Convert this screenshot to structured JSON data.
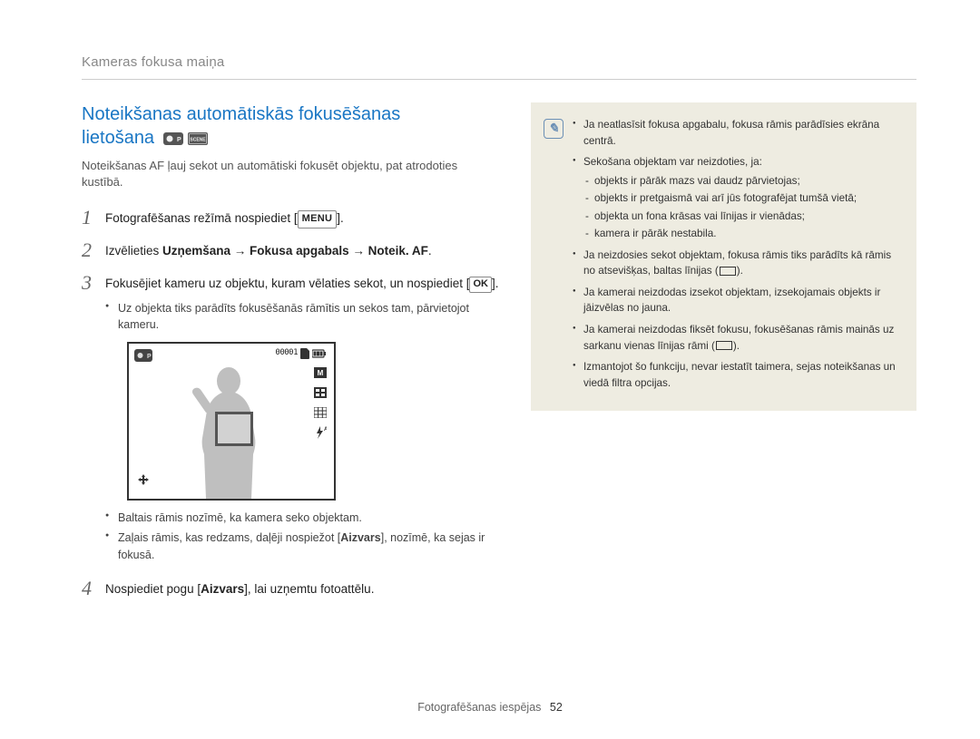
{
  "header": "Kameras fokusa maiņa",
  "title_line1": "Noteikšanas automātiskās fokusēšanas",
  "title_line2": "lietošana",
  "intro": "Noteikšanas AF ļauj sekot un automātiski fokusēt objektu, pat atrodoties kustībā.",
  "step1_pre": "Fotografēšanas režīmā nospiediet [",
  "step1_btn": "MENU",
  "step1_post": "].",
  "step2_pre": "Izvēlieties ",
  "step2_bold": "Uzņemšana → Fokusa apgabals → Noteik. AF",
  "step2_post": ".",
  "step3_pre": "Fokusējiet kameru uz objektu, kuram vēlaties sekot, un nospiediet [",
  "step3_btn": "OK",
  "step3_post": "].",
  "step3_sub1": "Uz objekta tiks parādīts fokusēšanās rāmītis un sekos tam, pārvietojot kameru.",
  "camera_counter": "00001",
  "step3_sub2": "Baltais rāmis nozīmē, ka kamera seko objektam.",
  "step3_sub3_pre": "Zaļais rāmis, kas redzams, daļēji nospiežot [",
  "step3_sub3_bold": "Aizvars",
  "step3_sub3_post": "], nozīmē, ka sejas ir fokusā.",
  "step4_pre": "Nospiediet pogu [",
  "step4_bold": "Aizvars",
  "step4_post": "], lai uzņemtu fotoattēlu.",
  "note": {
    "b1": "Ja neatlasīsit fokusa apgabalu, fokusa rāmis parādīsies ekrāna centrā.",
    "b2": "Sekošana objektam var neizdoties, ja:",
    "b2s1": "objekts ir pārāk mazs vai daudz pārvietojas;",
    "b2s2": "objekts ir pretgaismā vai arī jūs fotografējat tumšā vietā;",
    "b2s3": "objekta un fona krāsas vai līnijas ir vienādas;",
    "b2s4": "kamera ir pārāk nestabila.",
    "b3_pre": "Ja neizdosies sekot objektam, fokusa rāmis tiks parādīts kā rāmis no atsevišķas, baltas līnijas (",
    "b3_post": ").",
    "b4_pre": "Ja kamerai neizdodas izsekot objektam, izsekojamais objekts ir jāizvēlas no jauna.",
    "b5_pre": "Ja kamerai neizdodas fiksēt fokusu, fokusēšanas rāmis mainās uz sarkanu vienas līnijas rāmi (",
    "b5_post": ").",
    "b6": "Izmantojot šo funkciju, nevar iestatīt taimera, sejas noteikšanas un viedā filtra opcijas."
  },
  "footer_label": "Fotografēšanas iespējas",
  "footer_page": "52"
}
